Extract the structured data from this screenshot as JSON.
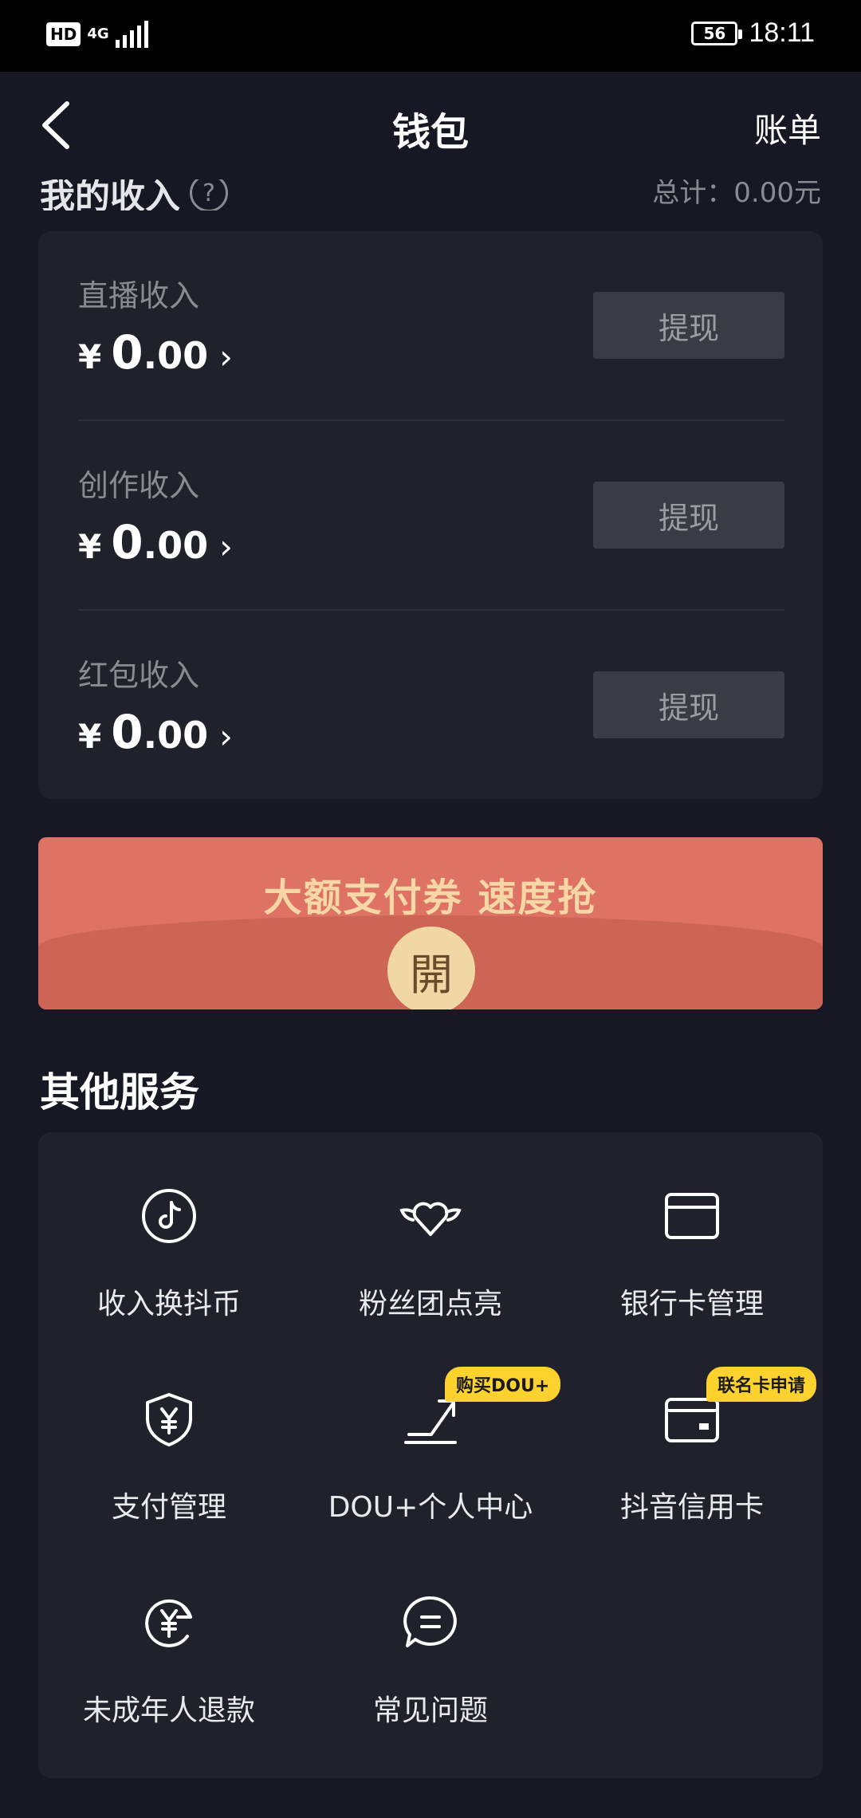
{
  "status_bar": {
    "hd": "HD",
    "network": "4G",
    "battery": "56",
    "time": "18:11"
  },
  "header": {
    "title": "钱包",
    "bill": "账单"
  },
  "income": {
    "title": "我的收入",
    "help": "?",
    "total": "总计：0.00元",
    "rows": [
      {
        "label": "直播收入",
        "currency": "¥",
        "int": "0",
        "dec": ".00",
        "button": "提现"
      },
      {
        "label": "创作收入",
        "currency": "¥",
        "int": "0",
        "dec": ".00",
        "button": "提现"
      },
      {
        "label": "红包收入",
        "currency": "¥",
        "int": "0",
        "dec": ".00",
        "button": "提现"
      }
    ]
  },
  "promo": {
    "text": "大额支付券 速度抢",
    "open": "開"
  },
  "services": {
    "title": "其他服务",
    "items": [
      {
        "label": "收入换抖币",
        "icon": "tiktok-coin-icon"
      },
      {
        "label": "粉丝团点亮",
        "icon": "winged-heart-icon"
      },
      {
        "label": "银行卡管理",
        "icon": "bank-card-icon"
      },
      {
        "label": "支付管理",
        "icon": "shield-yen-icon"
      },
      {
        "label": "DOU+个人中心",
        "icon": "trend-up-icon",
        "badge": "购买DOU+"
      },
      {
        "label": "抖音信用卡",
        "icon": "credit-card-icon",
        "badge": "联名卡申请"
      },
      {
        "label": "未成年人退款",
        "icon": "yen-refund-icon"
      },
      {
        "label": "常见问题",
        "icon": "chat-faq-icon"
      }
    ]
  },
  "colors": {
    "background": "#161823",
    "card": "#1f212b",
    "promo": "#dd7265",
    "badge": "#fdd22f"
  }
}
